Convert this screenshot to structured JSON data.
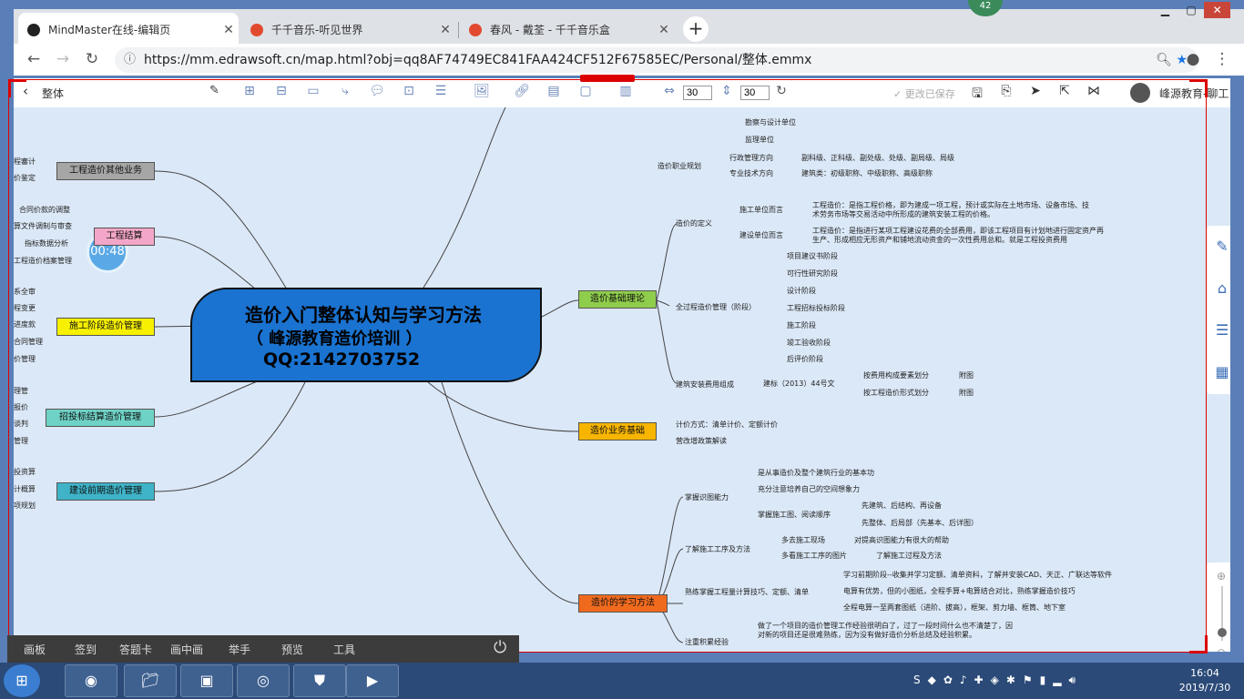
{
  "browser": {
    "tabs": [
      {
        "title": "MindMaster在线-编辑页",
        "color": "#222222"
      },
      {
        "title": "千千音乐-听见世界",
        "color": "#e24a2f"
      },
      {
        "title": "春风 - 戴荃 - 千千音乐盒",
        "color": "#e24a2f"
      }
    ],
    "url": "https://mm.edrawsoft.cn/map.html?obj=qq8AF74749EC841FAA424CF512F67585EC/Personal/整体.emmx",
    "badge": "42"
  },
  "toolbar": {
    "doc_title": "整体",
    "width_value": "30",
    "height_value": "30",
    "saved_status": "更改已保存",
    "user_name": "峰源教育-聊工"
  },
  "mindmap": {
    "central_line1": "造价入门整体认知与学习方法",
    "central_line2": "（ 峰源教育造价培训 ）",
    "central_line3": "QQ:2142703752",
    "timer": "00:48",
    "left_topics": [
      {
        "label": "工程造价其他业务",
        "color": "#a6a6a6"
      },
      {
        "label": "工程结算",
        "color": "#f4a6c8"
      },
      {
        "label": "施工阶段造价管理",
        "color": "#f7f000"
      },
      {
        "label": "招投标结算造价管理",
        "color": "#6fd2c6"
      },
      {
        "label": "建设前期造价管理",
        "color": "#3fb3c7"
      }
    ],
    "left_leaves": [
      "程審计",
      "价鉴定",
      "合同价款的调整",
      "算文件调制与审查",
      "指标数据分析",
      "工程造价档案管理",
      "系全审",
      "程变更",
      "进度款",
      "合同管理",
      "价管理",
      "理管",
      "报价",
      "谈判",
      "管理",
      "投资算",
      "计概算",
      "项规划"
    ],
    "right_topics": [
      {
        "label": "造价基础理论",
        "color": "#8fcd4c"
      },
      {
        "label": "造价业务基础",
        "color": "#f7b500"
      },
      {
        "label": "造价的学习方法",
        "color": "#f06a1e"
      }
    ],
    "right_leaves": [
      "勘察与设计单位",
      "监理单位",
      "造价职业规划",
      "行政管理方向",
      "副科级、正科级、副处级、处级、副局级、局级",
      "专业技术方向",
      "建筑类：初级职称、中级职称、高级职称",
      "造价的定义",
      "施工单位而言",
      "工程造价：是指工程价格，即为建成一项工程，预计或实际在土地市场、设备市场、技",
      "术劳务市场等交易活动中所形成的建筑安装工程的价格。",
      "建设单位而言",
      "工程造价：是指进行某项工程建设花费的全部费用，即该工程项目有计划地进行固定资产再",
      "生产、形成相应无形资产和铺地流动资金的一次性费用总和。就是工程投资费用",
      "全过程造价管理（阶段）",
      "项目建议书阶段",
      "可行性研究阶段",
      "设计阶段",
      "工程招标投标阶段",
      "施工阶段",
      "竣工验收阶段",
      "后评价阶段",
      "建筑安装费用组成",
      "建标（2013）44号文",
      "按费用构成要素划分",
      "附图",
      "按工程造价形式划分",
      "附图",
      "计价方式：清单计价、定额计价",
      "营改增政策解读",
      "掌握识图能力",
      "是从事造价及整个建筑行业的基本功",
      "充分注意培养自己的空间想象力",
      "掌握施工图、阅读顺序",
      "先建筑、后结构、再设备",
      "先整体、后局部（先基本、后详图）",
      "了解施工工序及方法",
      "多去施工现场",
      "对提高识图能力有很大的帮助",
      "多看施工工序的图片",
      "了解施工过程及方法",
      "熟练掌握工程量计算技巧、定额、清单",
      "学习前期阶段--收集并学习定额、清单资料，了解并安装CAD、天正、广联达等软件",
      "电算有优势，但的小图纸，全程手算+电算结合对比，熟练掌握造价技巧",
      "全程电算一至两套图纸（进阶、拔高），框架、剪力墙、框筒、地下室",
      "注重积累经验",
      "做了一个项目的造价管理工作经验很明白了，过了一段时间什么也不清楚了，因",
      "对新的项目还是很难熟练，因为没有做好造价分析总结及经验积累。"
    ]
  },
  "bottom_bar": [
    "画板",
    "签到",
    "答题卡",
    "画中画",
    "举手",
    "预览",
    "工具"
  ],
  "taskbar": {
    "time": "16:04",
    "date": "2019/7/30"
  }
}
